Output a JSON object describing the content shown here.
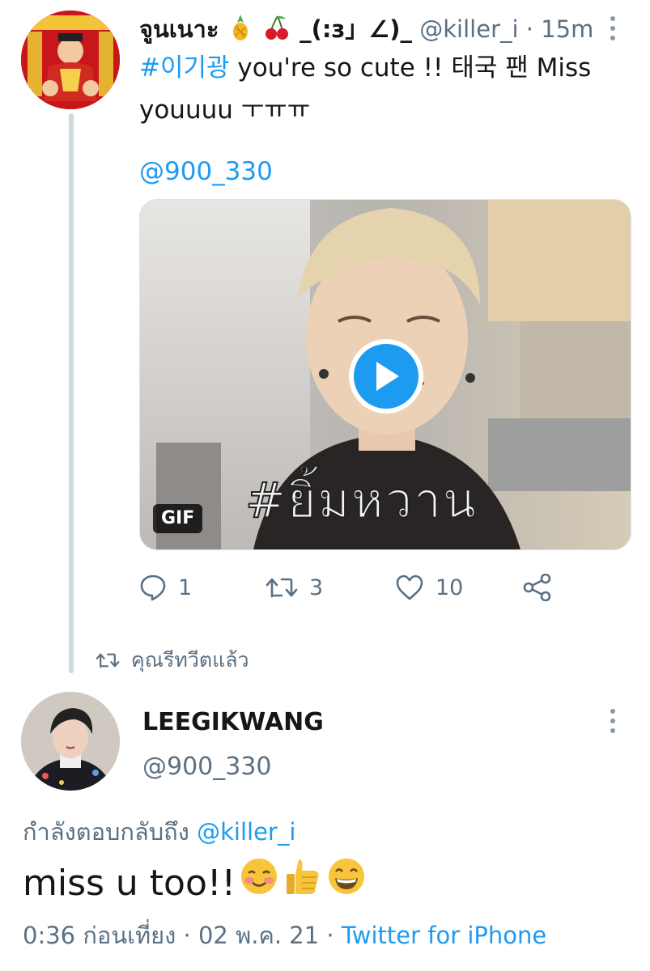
{
  "tweet1": {
    "name": "จูนเนาะ",
    "name_emojis": [
      "pineapple",
      "cherries"
    ],
    "name_suffix": "_(:з」∠)_",
    "handle": "@killer_i",
    "separator": "·",
    "time": "15m",
    "hashtag": "#이기광",
    "text_after_hashtag": " you're so cute !! 태국 팬 Miss youuuu ㅜㅠㅠ",
    "mention": "@900_330",
    "media": {
      "badge": "GIF",
      "overlay_text": "#ยิ้มหวาน",
      "play_icon": "play-icon"
    },
    "actions": {
      "reply_count": "1",
      "retweet_count": "3",
      "like_count": "10"
    }
  },
  "retweet_notice": {
    "label": "คุณรีทวีตแล้ว"
  },
  "tweet2": {
    "name": "LEEGIKWANG",
    "handle": "@900_330",
    "replying_prefix": "กำลังตอบกลับถึง ",
    "replying_to": "@killer_i",
    "text": "miss u too!!",
    "emojis": [
      "smiling-face-with-blush",
      "thumbs-up",
      "grinning-face"
    ],
    "time": "0:36 ก่อนเที่ยง",
    "date": "02 พ.ค. 21",
    "separator": "·",
    "source": "Twitter for iPhone"
  },
  "colors": {
    "accent": "#1d9bf0",
    "secondary_text": "#5b7083",
    "thread_line": "#cfd9de"
  }
}
